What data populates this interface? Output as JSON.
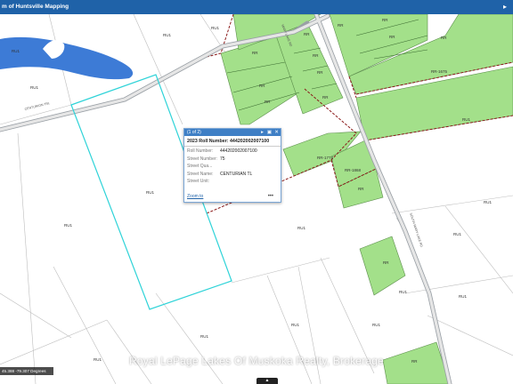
{
  "window": {
    "title": "m of Huntsville Mapping",
    "nav_icon": "chevron-right-icon"
  },
  "popup": {
    "count": "(1 of 2)",
    "title": "2023 Roll Number: 444202002007100",
    "fields": [
      {
        "key": "Roll Number:",
        "value": "444202002007100"
      },
      {
        "key": "Street Number:",
        "value": "75"
      },
      {
        "key": "Street Qua...",
        "value": ""
      },
      {
        "key": "Street Name:",
        "value": "CENTURIAN TL"
      },
      {
        "key": "Street Unit:",
        "value": ""
      }
    ],
    "zoom_label": "Zoom to",
    "more_label": "•••"
  },
  "map_labels": {
    "rr": "RR",
    "ru1": "RU1",
    "rr_1774": "RR-1774",
    "rr_1868": "RR-1868",
    "rr_1675": "RR-1675",
    "road_a": "CENTURION TRL",
    "road_b": "SOUTH MARY LAKE RD",
    "road_c": "MARY LAKE RD"
  },
  "coords": "45.388 -79.307 Degrees",
  "watermark": "Royal LePage Lakes Of Muskoka Realty, Brokerage",
  "collapse_icon": "chevron-up-icon",
  "colors": {
    "zone_green": "#a3e08a",
    "water": "#3d7bd6",
    "selection": "#2fd3d8",
    "titlebar": "#1f62a8"
  }
}
